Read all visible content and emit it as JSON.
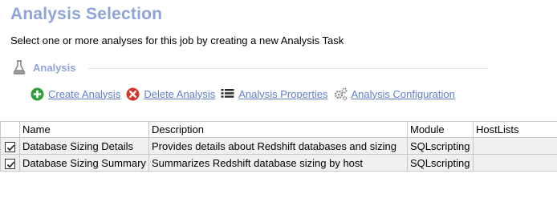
{
  "header": {
    "title": "Analysis Selection",
    "subtitle": "Select one or more analyses for this job by creating a new Analysis Task"
  },
  "section": {
    "label": "Analysis",
    "icon": "flask-icon"
  },
  "toolbar": {
    "create": {
      "label": "Create Analysis",
      "icon": "plus-circle-icon",
      "color": "#2e9d3a"
    },
    "delete": {
      "label": "Delete Analysis",
      "icon": "x-circle-icon",
      "color": "#d9342b"
    },
    "properties": {
      "label": "Analysis Properties",
      "icon": "list-icon"
    },
    "configuration": {
      "label": "Analysis Configuration",
      "icon": "gears-icon"
    }
  },
  "table": {
    "columns": [
      "Name",
      "Description",
      "Module",
      "HostLists"
    ],
    "rows": [
      {
        "checked": true,
        "name": "Database Sizing Details",
        "description": "Provides details about Redshift databases and sizing",
        "module": "SQLscripting",
        "hostlists": ""
      },
      {
        "checked": true,
        "name": "Database Sizing Summary",
        "description": "Summarizes Redshift database sizing by host",
        "module": "SQLscripting",
        "hostlists": ""
      }
    ]
  },
  "colors": {
    "accent": "#8ea4d8",
    "link": "#5f7fc8",
    "row_bg": "#f0f0f0",
    "grid_line": "#c8c8c8"
  }
}
